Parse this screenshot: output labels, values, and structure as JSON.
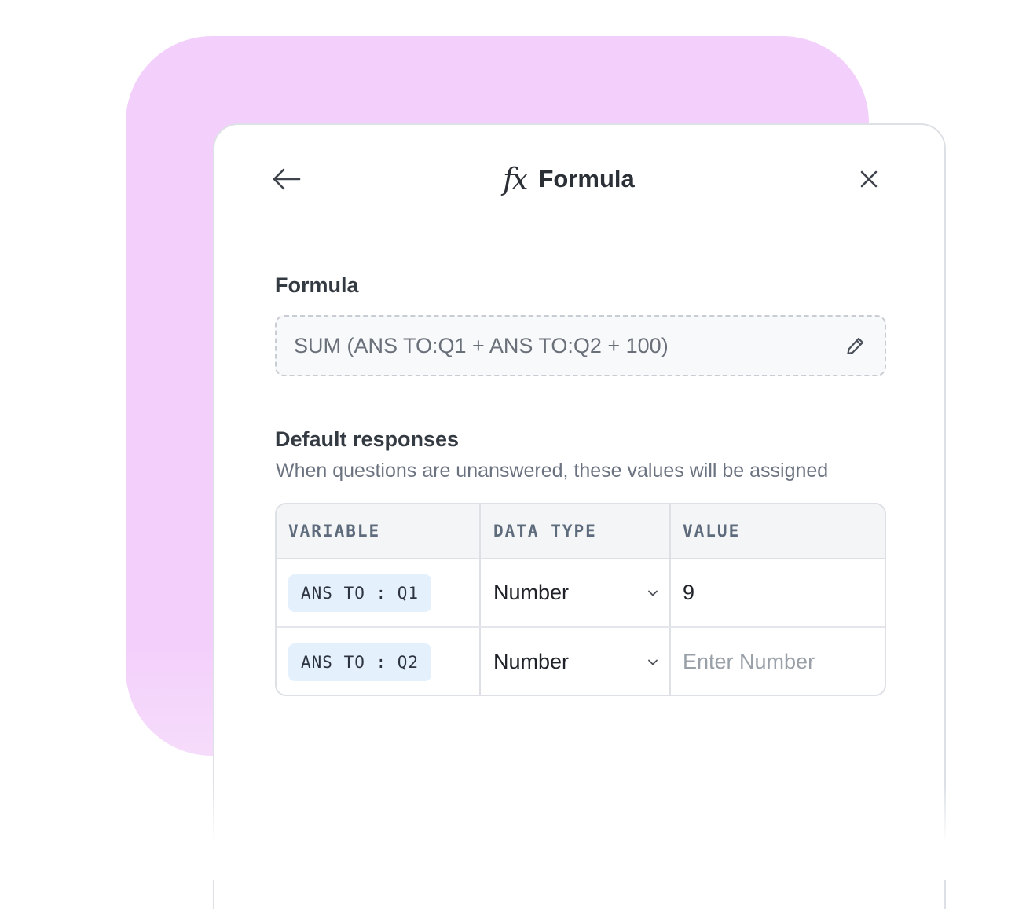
{
  "header": {
    "title": "Formula",
    "fx_symbol": "fx",
    "back_icon": "arrow-left-icon",
    "close_icon": "close-icon"
  },
  "formula": {
    "label": "Formula",
    "expression": "SUM (ANS TO:Q1 + ANS TO:Q2 + 100)",
    "edit_icon": "pencil-icon"
  },
  "defaults": {
    "label": "Default responses",
    "helper": "When questions are unanswered, these values will be assigned",
    "columns": [
      "VARIABLE",
      "DATA TYPE",
      "VALUE"
    ],
    "rows": [
      {
        "variable": "ANS TO : Q1",
        "data_type": "Number",
        "value": "9",
        "placeholder": ""
      },
      {
        "variable": "ANS TO : Q2",
        "data_type": "Number",
        "value": "",
        "placeholder": "Enter Number"
      }
    ]
  },
  "colors": {
    "background_blob": "#f3d0fb",
    "chip": "#e4f1fd",
    "header_row": "#f4f5f6"
  }
}
